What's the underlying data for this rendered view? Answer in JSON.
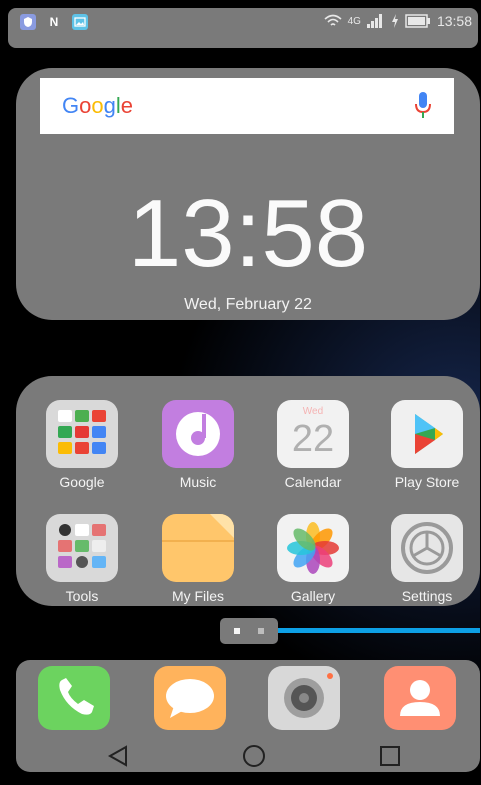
{
  "status_bar": {
    "time": "13:58",
    "network": "4G",
    "left_icons": [
      "shield-app-icon",
      "nfc-icon",
      "image-notification-icon"
    ],
    "nfc_letter": "N"
  },
  "search_widget": {
    "logo_text": [
      "G",
      "o",
      "o",
      "g",
      "l",
      "e"
    ],
    "logo_colors": [
      "#4285f4",
      "#ea4335",
      "#fbbc05",
      "#4285f4",
      "#34a853",
      "#ea4335"
    ]
  },
  "clock": {
    "time": "13:58",
    "date": "Wed, February 22"
  },
  "apps": [
    {
      "label": "Google",
      "icon": "google-folder-icon"
    },
    {
      "label": "Music",
      "icon": "music-icon"
    },
    {
      "label": "Calendar",
      "icon": "calendar-icon",
      "day_name": "Wed",
      "day_number": "22"
    },
    {
      "label": "Play Store",
      "icon": "play-store-icon"
    },
    {
      "label": "Tools",
      "icon": "tools-folder-icon"
    },
    {
      "label": "My Files",
      "icon": "my-files-icon"
    },
    {
      "label": "Gallery",
      "icon": "gallery-icon"
    },
    {
      "label": "Settings",
      "icon": "settings-icon"
    }
  ],
  "page_indicator": {
    "pages": 2,
    "current": 1
  },
  "dock": [
    {
      "icon": "phone-icon"
    },
    {
      "icon": "messages-icon"
    },
    {
      "icon": "camera-icon"
    },
    {
      "icon": "contacts-icon"
    }
  ],
  "nav_bar": [
    "back-icon",
    "home-icon",
    "recents-icon"
  ],
  "colors": {
    "panel": "#7a7a7a",
    "accent_line": "#0da0e6"
  }
}
